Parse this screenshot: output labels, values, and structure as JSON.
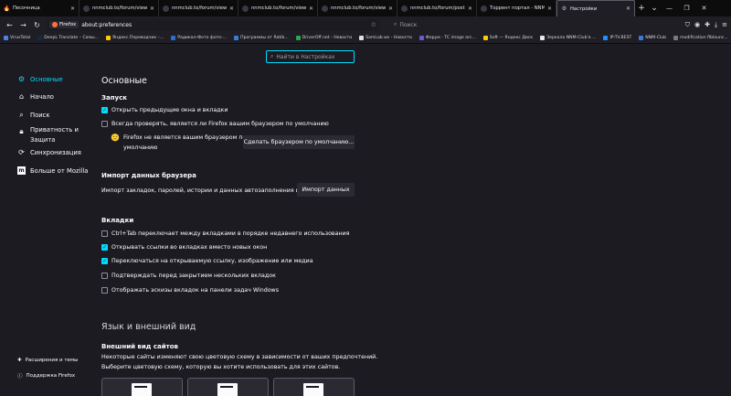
{
  "tabs": [
    {
      "title": "Песочница",
      "icon": "fire-icon",
      "active": false
    },
    {
      "title": "nnmclub.to/forum/viewtopic",
      "icon": "nnm-icon",
      "active": false
    },
    {
      "title": "nnmclub.to/forum/viewtopic",
      "icon": "nnm-icon",
      "active": false
    },
    {
      "title": "nnmclub.to/forum/viewtopic",
      "icon": "nnm-icon",
      "active": false
    },
    {
      "title": "nnmclub.to/forum/viewtopic",
      "icon": "nnm-icon",
      "active": false
    },
    {
      "title": "nnmclub.to/forum/posting",
      "icon": "nnm-icon",
      "active": false
    },
    {
      "title": "Торрент портал - NNM-Clu",
      "icon": "nnm-icon",
      "active": false
    },
    {
      "title": "Настройки",
      "icon": "gear-icon",
      "active": true
    }
  ],
  "toolbar": {
    "identity_label": "Firefox",
    "url": "about:preferences",
    "search_placeholder": "Поиск"
  },
  "bookmarks": [
    {
      "label": "VirusTotal",
      "color": "#4f7ee8"
    },
    {
      "label": "DeepL Translate – Самы...",
      "color": "#0f2b46"
    },
    {
      "label": "Яндекс.Переводчик –...",
      "color": "#ffcc00"
    },
    {
      "label": "Радикал-Фото фото-...",
      "color": "#2e6ccf"
    },
    {
      "label": "Программы от Ratib...",
      "color": "#3a7bd5"
    },
    {
      "label": "DriverOff.net - Новости",
      "color": "#2aa84a"
    },
    {
      "label": "SamLab.ws - Новости",
      "color": "#e0e0e0"
    },
    {
      "label": "Форум - TC image arc...",
      "color": "#6a5acd"
    },
    {
      "label": "Soft — Яндекс Диск",
      "color": "#ffcc00"
    },
    {
      "label": "Зеркала NNM-Club'a ...",
      "color": "#e8e8e8"
    },
    {
      "label": "IP-TV.BEST",
      "color": "#1e90ff"
    },
    {
      "label": "NNM-Club",
      "color": "#3a7bd5"
    },
    {
      "label": "modification flblaunc...",
      "color": "#7a7a7a"
    }
  ],
  "find": {
    "placeholder": "Найти в Настройках"
  },
  "sidebar": {
    "items": [
      {
        "label": "Основные",
        "icon": "gear-icon",
        "selected": true
      },
      {
        "label": "Начало",
        "icon": "home-icon",
        "selected": false
      },
      {
        "label": "Поиск",
        "icon": "search-icon",
        "selected": false
      },
      {
        "label_1": "Приватность и",
        "label_2": "Защита",
        "icon": "lock-icon",
        "selected": false
      },
      {
        "label": "Синхронизация",
        "icon": "sync-icon",
        "selected": false
      },
      {
        "label": "Больше от Mozilla",
        "icon": "mozilla-icon",
        "selected": false
      }
    ],
    "footer": [
      {
        "label": "Расширения и темы",
        "icon": "puzzle-icon"
      },
      {
        "label": "Поддержка Firefox",
        "icon": "help-icon"
      }
    ]
  },
  "main": {
    "page_title": "Основные",
    "startup": {
      "heading": "Запуск",
      "restore_session": {
        "label": "Открыть предыдущие окна и вкладки",
        "checked": true
      },
      "check_default": {
        "label": "Всегда проверять, является ли Firefox вашим браузером по умолчанию",
        "checked": false
      },
      "default_status_1": "Firefox не является вашим браузером по",
      "default_status_2": "умолчанию",
      "make_default_button": "Сделать браузером по умолчанию..."
    },
    "import": {
      "heading": "Импорт данных браузера",
      "description": "Импорт закладок, паролей, истории и данных автозаполнения в Firefox.",
      "button": "Импорт данных"
    },
    "tabs_section": {
      "heading": "Вкладки",
      "options": [
        {
          "label": "Ctrl+Tab переключает между вкладками в порядке недавнего использования",
          "checked": false
        },
        {
          "label": "Открывать ссылки во вкладках вместо новых окон",
          "checked": true
        },
        {
          "label": "Переключаться на открываемую ссылку, изображение или медиа",
          "checked": true
        },
        {
          "label": "Подтверждать перед закрытием нескольких вкладок",
          "checked": false
        },
        {
          "label": "Отображать эскизы вкладок на панели задач Windows",
          "checked": false
        }
      ]
    },
    "language_section": {
      "heading": "Язык и внешний вид",
      "appearance_heading": "Внешний вид сайтов",
      "description_1": "Некоторые сайты изменяют свою цветовую схему в зависимости от ваших предпочтений.",
      "description_2": "Выберите цветовую схему, которую вы хотите использовать для этих сайтов."
    }
  },
  "colors": {
    "accent": "#00ddff",
    "background": "#1c1b22",
    "chrome": "#1f1e25"
  }
}
